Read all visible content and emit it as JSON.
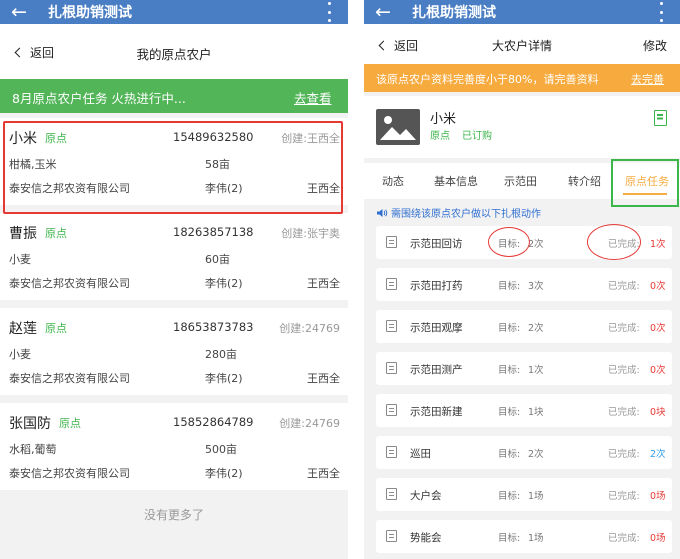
{
  "left": {
    "appbar": {
      "back_icon": "arrow-left-icon",
      "title": "扎根助销测试",
      "more_icon": "more-vertical-icon"
    },
    "nav": {
      "back_label": "返回",
      "title": "我的原点农户"
    },
    "banner": {
      "text": "8月原点农户任务 火热进行中...",
      "link": "去查看",
      "color": "#52b558"
    },
    "farmers": [
      {
        "name": "小米",
        "tag": "原点",
        "phone": "15489632580",
        "creator": "创建:王西全",
        "crops": "柑橘,玉米",
        "area": "58亩",
        "company": "泰安信之邦农资有限公司",
        "assignee": "李伟(2)",
        "owner": "王西全"
      },
      {
        "name": "曹振",
        "tag": "原点",
        "phone": "18263857138",
        "creator": "创建:张宇奥",
        "crops": "小麦",
        "area": "60亩",
        "company": "泰安信之邦农资有限公司",
        "assignee": "李伟(2)",
        "owner": "王西全"
      },
      {
        "name": "赵莲",
        "tag": "原点",
        "phone": "18653873783",
        "creator": "创建:24769",
        "crops": "小麦",
        "area": "280亩",
        "company": "泰安信之邦农资有限公司",
        "assignee": "李伟(2)",
        "owner": "王西全"
      },
      {
        "name": "张国防",
        "tag": "原点",
        "phone": "15852864789",
        "creator": "创建:24769",
        "crops": "水稻,葡萄",
        "area": "500亩",
        "company": "泰安信之邦农资有限公司",
        "assignee": "李伟(2)",
        "owner": "王西全"
      }
    ],
    "footer": "没有更多了"
  },
  "right": {
    "appbar": {
      "back_icon": "arrow-left-icon",
      "title": "扎根助销测试",
      "more_icon": "more-vertical-icon"
    },
    "nav": {
      "back_label": "返回",
      "title": "大农户详情",
      "edit": "修改"
    },
    "notice": {
      "text": "该原点农户资料完善度小于80%，请完善资料",
      "link": "去完善",
      "color": "#f7ab3f"
    },
    "profile": {
      "avatar_icon": "image-placeholder-icon",
      "name": "小米",
      "tag1": "原点",
      "tag2": "已订购",
      "bookmark_icon": "bookmark-icon"
    },
    "tabs": [
      "动态",
      "基本信息",
      "示范田",
      "转介绍",
      "原点任务"
    ],
    "active_tab": 4,
    "hint_icon": "speaker-icon",
    "hint": "需围绕该原点农户做以下扎根动作",
    "tasks": [
      {
        "name": "示范田回访",
        "target_label": "目标:",
        "target": "2次",
        "done_label": "已完成:",
        "done": "1次",
        "done_color": "#e53935"
      },
      {
        "name": "示范田打药",
        "target_label": "目标:",
        "target": "3次",
        "done_label": "已完成:",
        "done": "0次",
        "done_color": "#e53935"
      },
      {
        "name": "示范田观摩",
        "target_label": "目标:",
        "target": "2次",
        "done_label": "已完成:",
        "done": "0次",
        "done_color": "#e53935"
      },
      {
        "name": "示范田测产",
        "target_label": "目标:",
        "target": "1次",
        "done_label": "已完成:",
        "done": "0次",
        "done_color": "#e53935"
      },
      {
        "name": "示范田新建",
        "target_label": "目标:",
        "target": "1块",
        "done_label": "已完成:",
        "done": "0块",
        "done_color": "#e53935"
      },
      {
        "name": "巡田",
        "target_label": "目标:",
        "target": "2次",
        "done_label": "已完成:",
        "done": "2次",
        "done_color": "#2f9be6"
      },
      {
        "name": "大户会",
        "target_label": "目标:",
        "target": "1场",
        "done_label": "已完成:",
        "done": "0场",
        "done_color": "#e53935"
      },
      {
        "name": "势能会",
        "target_label": "目标:",
        "target": "1场",
        "done_label": "已完成:",
        "done": "0场",
        "done_color": "#e53935"
      }
    ]
  },
  "colors": {
    "appbar": "#4a7ec4",
    "tag_green": "#3cb54a",
    "highlight_red": "#e53935",
    "active_tab": "#f7ab3f"
  }
}
